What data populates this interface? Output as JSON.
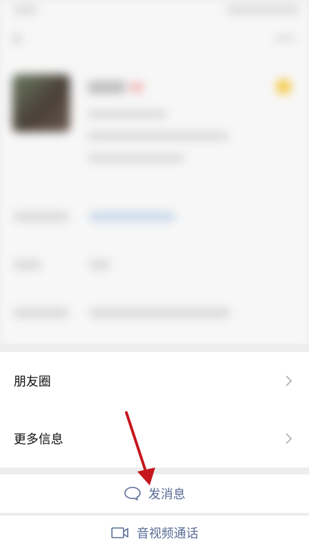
{
  "menu": {
    "moments_label": "朋友圈",
    "more_info_label": "更多信息"
  },
  "actions": {
    "send_message_label": "发消息",
    "av_call_label": "音视频通话"
  },
  "colors": {
    "link": "#576b95",
    "annotation_arrow": "#c4161c"
  },
  "icons": {
    "chevron": "chevron-right-icon",
    "message": "chat-bubble-icon",
    "video": "video-camera-icon"
  }
}
